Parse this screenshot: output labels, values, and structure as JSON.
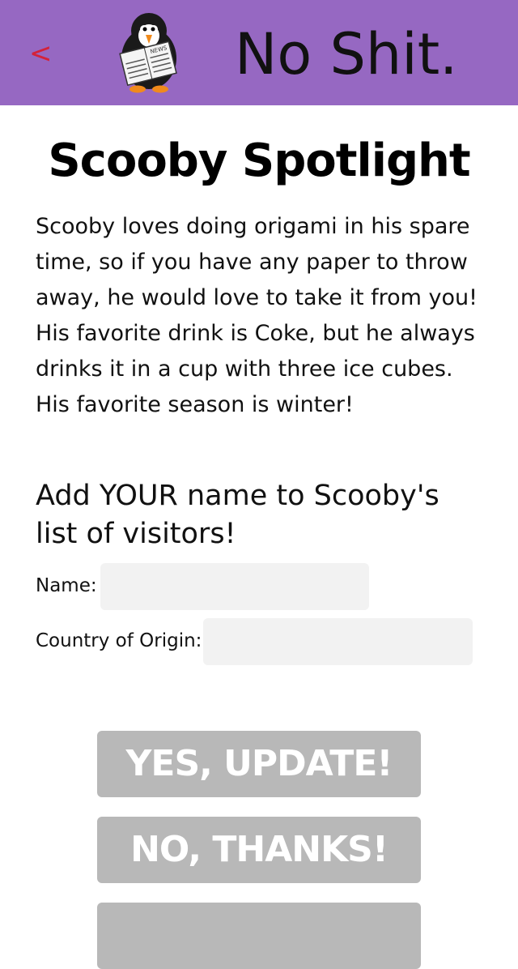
{
  "header": {
    "back_label": "<",
    "brand": "No Shit.",
    "logo_news_text": "NEWS",
    "background_color": "#9668c2",
    "back_color": "#d4223a"
  },
  "page": {
    "title": "Scooby Spotlight",
    "bio": "Scooby loves doing origami in his spare time, so if you have any paper to throw away, he would love to take it from you! His favorite drink is Coke, but he always drinks it in a cup with three ice cubes. His favorite season is winter!"
  },
  "form": {
    "heading": "Add YOUR name to Scooby's list of visitors!",
    "name_label": "Name:",
    "name_value": "",
    "country_label": "Country of Origin:",
    "country_value": "",
    "input_color": "#f2f2f2"
  },
  "buttons": {
    "update_label": "YES, UPDATE!",
    "no_thanks_label": "NO, THANKS!",
    "third_label": "",
    "button_color": "#b8b8b8"
  }
}
